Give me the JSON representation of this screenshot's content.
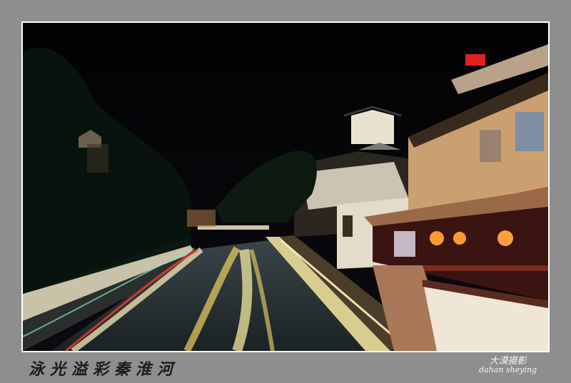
{
  "caption": "泳光溢彩秦淮河",
  "signature": {
    "top": "大漠摄影",
    "bottom": "dahan sheying"
  }
}
